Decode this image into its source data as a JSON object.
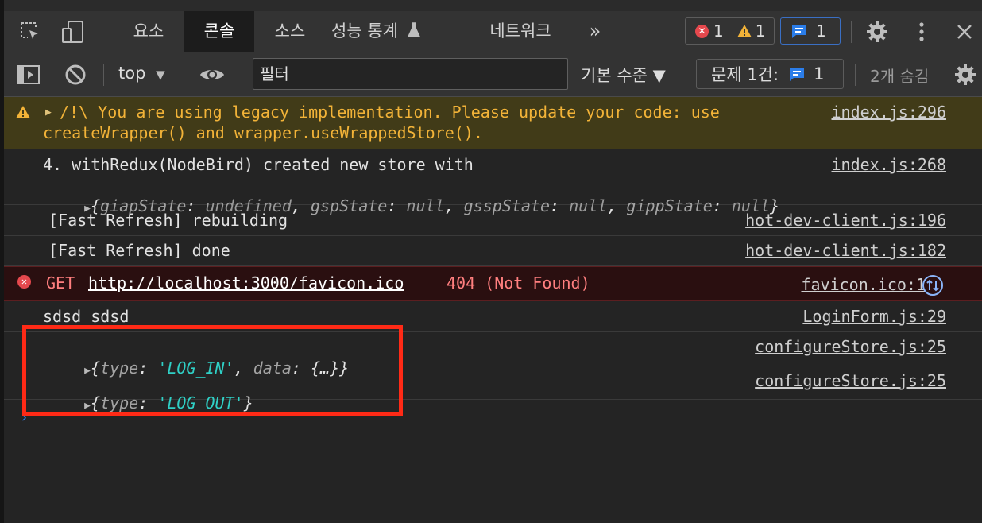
{
  "tabs": [
    "요소",
    "콘솔",
    "소스",
    "성능 통계",
    "네트워크"
  ],
  "tab_overflow": "»",
  "counters": {
    "errors": "1",
    "warnings": "1",
    "messages": "1"
  },
  "filterbar": {
    "context": "top",
    "filter_placeholder": "필터",
    "level": "기본 수준 ▼",
    "issues_label": "문제 1건:",
    "issues_count": "1",
    "hidden": "2개 숨김"
  },
  "messages": [
    {
      "type": "warning",
      "text_line1": "/!\\ You are using legacy implementation. Please update your code: use",
      "text_line2": "createWrapper() and wrapper.useWrappedStore().",
      "source": "index.js:296"
    },
    {
      "type": "log",
      "text": "4. withRedux(NodeBird) created new store with",
      "object_keys": [
        "giapState",
        "gspState",
        "gsspState",
        "gippState"
      ],
      "object_values": [
        "undefined",
        "null",
        "null",
        "null"
      ],
      "source": "index.js:268"
    },
    {
      "type": "log",
      "text": "[Fast Refresh] rebuilding",
      "source": "hot-dev-client.js:196"
    },
    {
      "type": "log",
      "text": "[Fast Refresh] done",
      "source": "hot-dev-client.js:182"
    },
    {
      "type": "error",
      "method": "GET",
      "url": "http://localhost:3000/favicon.ico",
      "status": "404 (Not Found)",
      "source": "favicon.ico:1"
    },
    {
      "type": "log",
      "text": "sdsd sdsd",
      "source": "LoginForm.js:29"
    },
    {
      "type": "object",
      "type_key": "type",
      "type_value": "'LOG_IN'",
      "data_key": "data",
      "data_value": "{…}",
      "source": "configureStore.js:25"
    },
    {
      "type": "object",
      "type_key": "type",
      "type_value": "'LOG_OUT'",
      "source": "configureStore.js:25"
    }
  ],
  "colors": {
    "background": "#242424",
    "toolbar": "#333333",
    "warning_bg": "#413b18",
    "warning_text": "#f2b338",
    "error_bg": "#2a0f10",
    "error_text": "#ff7f7f",
    "string_value": "#2fd0c6",
    "highlight": "#ff2a16",
    "info_blue": "#2b7de9"
  },
  "icons": [
    "inspect-icon",
    "device-icon",
    "settings-icon",
    "more-icon",
    "close-icon",
    "sidebar-icon",
    "clear-icon",
    "eye-icon",
    "filter-settings-icon",
    "network-request-icon"
  ]
}
